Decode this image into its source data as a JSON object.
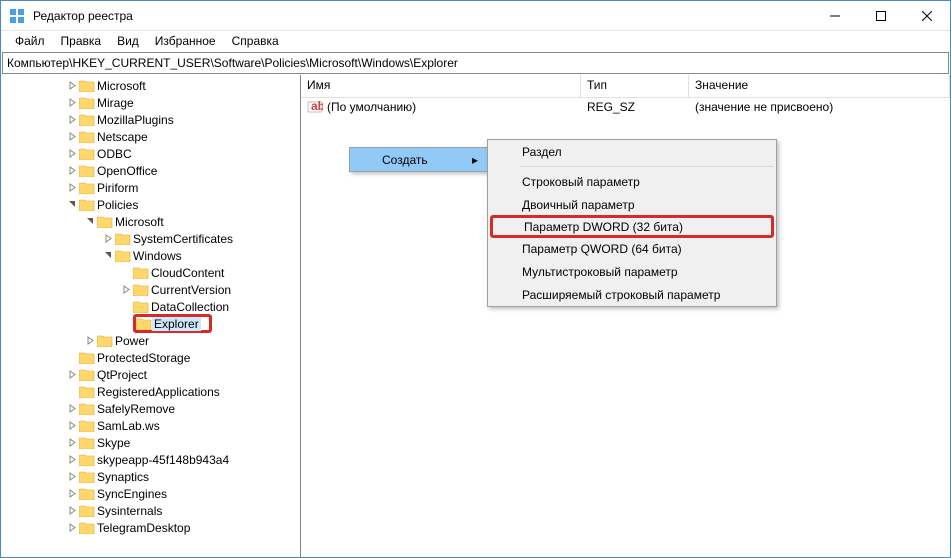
{
  "window": {
    "title": "Редактор реестра"
  },
  "menu": {
    "file": "Файл",
    "edit": "Правка",
    "view": "Вид",
    "favorites": "Избранное",
    "help": "Справка"
  },
  "path": "Компьютер\\HKEY_CURRENT_USER\\Software\\Policies\\Microsoft\\Windows\\Explorer",
  "columns": {
    "name": "Имя",
    "type": "Тип",
    "value": "Значение"
  },
  "default_value": {
    "name": "(По умолчанию)",
    "type": "REG_SZ",
    "value": "(значение не присвоено)"
  },
  "tree": {
    "microsoft": "Microsoft",
    "mirage": "Mirage",
    "mozillaplugins": "MozillaPlugins",
    "netscape": "Netscape",
    "odbc": "ODBC",
    "openoffice": "OpenOffice",
    "piriform": "Piriform",
    "policies": "Policies",
    "policies_microsoft": "Microsoft",
    "systemcertificates": "SystemCertificates",
    "windows": "Windows",
    "cloudcontent": "CloudContent",
    "currentversion": "CurrentVersion",
    "datacollection": "DataCollection",
    "explorer": "Explorer",
    "power": "Power",
    "protectedstorage": "ProtectedStorage",
    "qtproject": "QtProject",
    "registeredapplications": "RegisteredApplications",
    "safelyremove": "SafelyRemove",
    "samlab": "SamLab.ws",
    "skype": "Skype",
    "skypeapp": "skypeapp-45f148b943a4",
    "synaptics": "Synaptics",
    "syncengines": "SyncEngines",
    "sysinternals": "Sysinternals",
    "telegram": "TelegramDesktop"
  },
  "context_menu": {
    "create": "Создать",
    "section": "Раздел",
    "string": "Строковый параметр",
    "binary": "Двоичный параметр",
    "dword": "Параметр DWORD (32 бита)",
    "qword": "Параметр QWORD (64 бита)",
    "multi": "Мультистроковый параметр",
    "expand": "Расширяемый строковый параметр"
  }
}
